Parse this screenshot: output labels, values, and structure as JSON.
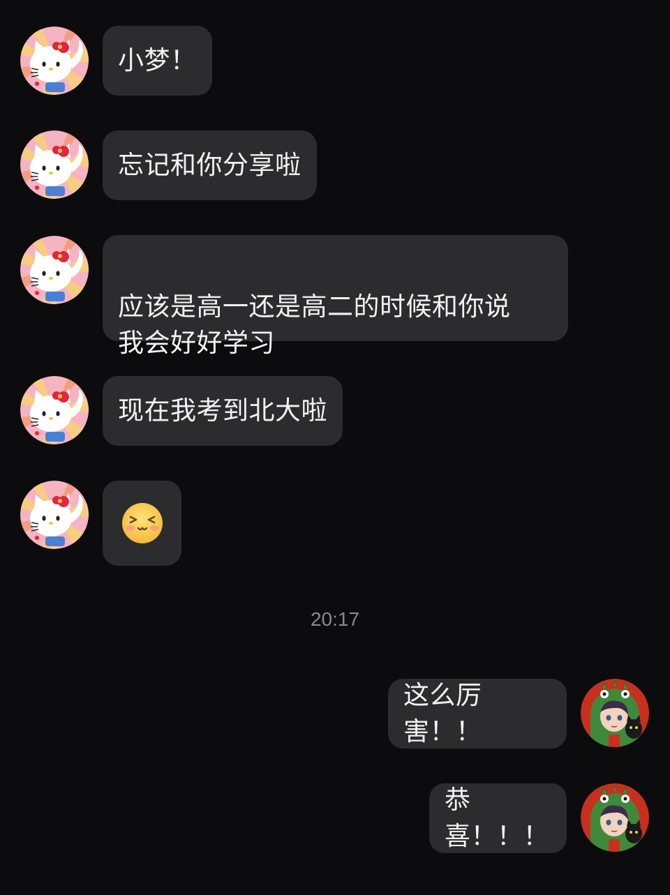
{
  "chat": {
    "incoming": [
      {
        "text": "小梦！"
      },
      {
        "text": "忘记和你分享啦"
      },
      {
        "text": "应该是高一还是高二的时候和你说\n我会好好学习"
      },
      {
        "text": "现在我考到北大啦"
      },
      {
        "emoji": "laughing-blush-emoji-icon"
      }
    ],
    "timestamp": "20:17",
    "outgoing": [
      {
        "text": "这么厉害！！"
      },
      {
        "text": "恭喜！！！"
      }
    ]
  },
  "colors": {
    "background": "#0c0c0e",
    "bubble": "#2c2c2e",
    "text": "#f2f2f2",
    "timestamp": "#8a8a8e"
  },
  "avatars": {
    "contact": "hello-kitty-avatar-icon",
    "self": "anime-boy-dino-hoodie-avatar-icon"
  }
}
